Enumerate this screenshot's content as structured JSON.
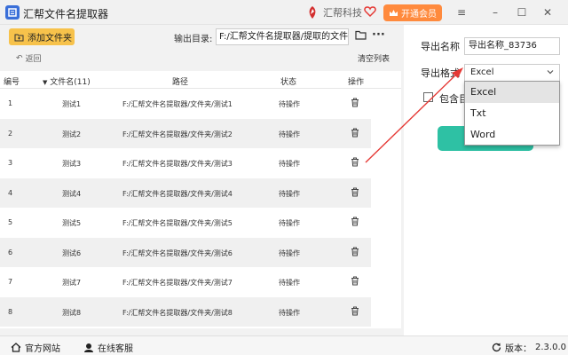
{
  "app": {
    "title": "汇帮文件名提取器",
    "brand": "汇帮科技",
    "vip_label": "开通会员",
    "logo_icon": "app-logo-icon"
  },
  "colors": {
    "accent": "#f7c24b",
    "vip": "#ff8a3d",
    "start": "#2ec1a4",
    "arrow": "#e53935"
  },
  "toolbar": {
    "add_folder_label": "添加文件夹",
    "output_dir_label": "输出目录:",
    "output_dir_value": "F:/汇帮文件名提取器/提取的文件名",
    "back_label": "返回",
    "clear_label": "清空列表"
  },
  "table": {
    "headers": {
      "index": "编号",
      "name": "文件名(11)",
      "path": "路径",
      "status": "状态",
      "action": "操作"
    },
    "rows": [
      {
        "index": "1",
        "name": "测试1",
        "path": "F:/汇帮文件名提取器/文件夹/测试1",
        "status": "待操作"
      },
      {
        "index": "2",
        "name": "测试2",
        "path": "F:/汇帮文件名提取器/文件夹/测试2",
        "status": "待操作"
      },
      {
        "index": "3",
        "name": "测试3",
        "path": "F:/汇帮文件名提取器/文件夹/测试3",
        "status": "待操作"
      },
      {
        "index": "4",
        "name": "测试4",
        "path": "F:/汇帮文件名提取器/文件夹/测试4",
        "status": "待操作"
      },
      {
        "index": "5",
        "name": "测试5",
        "path": "F:/汇帮文件名提取器/文件夹/测试5",
        "status": "待操作"
      },
      {
        "index": "6",
        "name": "测试6",
        "path": "F:/汇帮文件名提取器/文件夹/测试6",
        "status": "待操作"
      },
      {
        "index": "7",
        "name": "测试7",
        "path": "F:/汇帮文件名提取器/文件夹/测试7",
        "status": "待操作"
      },
      {
        "index": "8",
        "name": "测试8",
        "path": "F:/汇帮文件名提取器/文件夹/测试8",
        "status": "待操作"
      }
    ]
  },
  "settings": {
    "export_name_label": "导出名称",
    "export_name_value": "导出名称_83736",
    "export_format_label": "导出格式",
    "export_format_value": "Excel",
    "include_label": "包含目",
    "format_options": [
      "Excel",
      "Txt",
      "Word"
    ]
  },
  "statusbar": {
    "website_label": "官方网站",
    "support_label": "在线客服",
    "version_label": "版本：",
    "version_value": "2.3.0.0"
  }
}
